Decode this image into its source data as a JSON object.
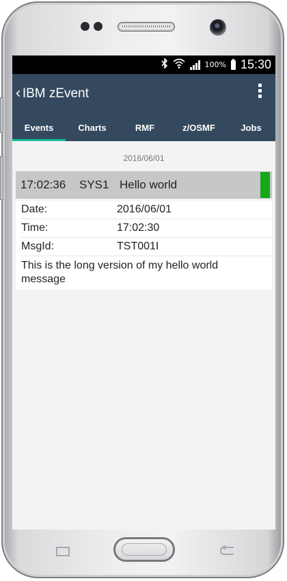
{
  "status_bar": {
    "icons": [
      "bluetooth-icon",
      "wifi-icon",
      "signal-icon",
      "battery-icon"
    ],
    "battery_percent": "100%",
    "time": "15:30"
  },
  "app_bar": {
    "back_glyph": "‹",
    "title": "IBM zEvent",
    "menu_icon": "overflow-menu-icon"
  },
  "tabs": [
    {
      "label": "Events",
      "active": true
    },
    {
      "label": "Charts",
      "active": false
    },
    {
      "label": "RMF",
      "active": false
    },
    {
      "label": "z/OSMF",
      "active": false
    },
    {
      "label": "Jobs",
      "active": false
    }
  ],
  "events": {
    "date_header": "2016/06/01",
    "selected_event": {
      "time": "17:02:36",
      "system": "SYS1",
      "message": "Hello world",
      "severity_color": "#16a616"
    },
    "details": {
      "date_label": "Date:",
      "date_value": "2016/06/01",
      "time_label": "Time:",
      "time_value": "17:02:30",
      "msgid_label": "MsgId:",
      "msgid_value": "TST001I",
      "long_message": "This is the long version of my hello world message"
    }
  },
  "colors": {
    "app_bar": "#34495e",
    "tab_indicator": "#1abc9c",
    "content_bg": "#f3f3f3",
    "selected_row_bg": "#c7c7c7"
  }
}
